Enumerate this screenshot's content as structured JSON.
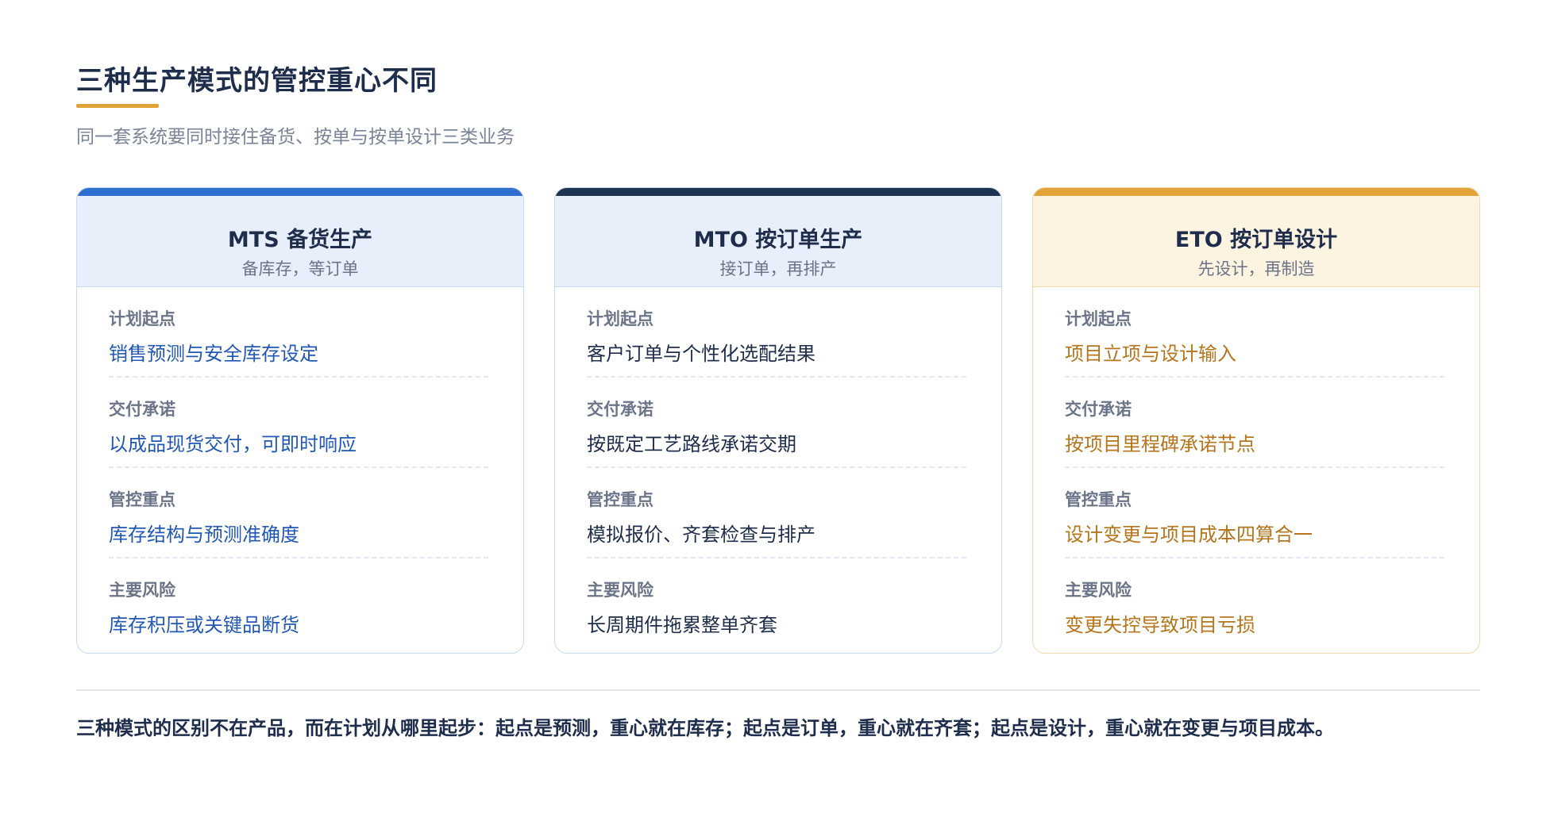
{
  "header": {
    "title": "三种生产模式的管控重心不同",
    "subtitle": "同一套系统要同时接住备货、按单与按单设计三类业务"
  },
  "colors": {
    "mts_accent": "#2f6fcf",
    "mts_head_bg": "#e8eefa",
    "mts_text": "#2158b6",
    "mto_accent": "#1f3353",
    "mto_head_bg": "#e8eefa",
    "mto_text": "#1f2d4d",
    "eto_accent": "#e2a43a",
    "eto_head_bg": "#fdf3e1",
    "eto_text": "#b5751c",
    "eto_border": "#f3d9a8"
  },
  "cards": [
    {
      "title": "MTS 备货生产",
      "subtitle": "备库存，等订单",
      "rows": [
        {
          "label": "计划起点",
          "value": "销售预测与安全库存设定"
        },
        {
          "label": "交付承诺",
          "value": "以成品现货交付，可即时响应"
        },
        {
          "label": "管控重点",
          "value": "库存结构与预测准确度"
        },
        {
          "label": "主要风险",
          "value": "库存积压或关键品断货"
        }
      ]
    },
    {
      "title": "MTO 按订单生产",
      "subtitle": "接订单，再排产",
      "rows": [
        {
          "label": "计划起点",
          "value": "客户订单与个性化选配结果"
        },
        {
          "label": "交付承诺",
          "value": "按既定工艺路线承诺交期"
        },
        {
          "label": "管控重点",
          "value": "模拟报价、齐套检查与排产"
        },
        {
          "label": "主要风险",
          "value": "长周期件拖累整单齐套"
        }
      ]
    },
    {
      "title": "ETO 按订单设计",
      "subtitle": "先设计，再制造",
      "rows": [
        {
          "label": "计划起点",
          "value": "项目立项与设计输入"
        },
        {
          "label": "交付承诺",
          "value": "按项目里程碑承诺节点"
        },
        {
          "label": "管控重点",
          "value": "设计变更与项目成本四算合一"
        },
        {
          "label": "主要风险",
          "value": "变更失控导致项目亏损"
        }
      ]
    }
  ],
  "footer": {
    "conclusion": "三种模式的区别不在产品，而在计划从哪里起步：起点是预测，重心就在库存；起点是订单，重心就在齐套；起点是设计，重心就在变更与项目成本。"
  }
}
